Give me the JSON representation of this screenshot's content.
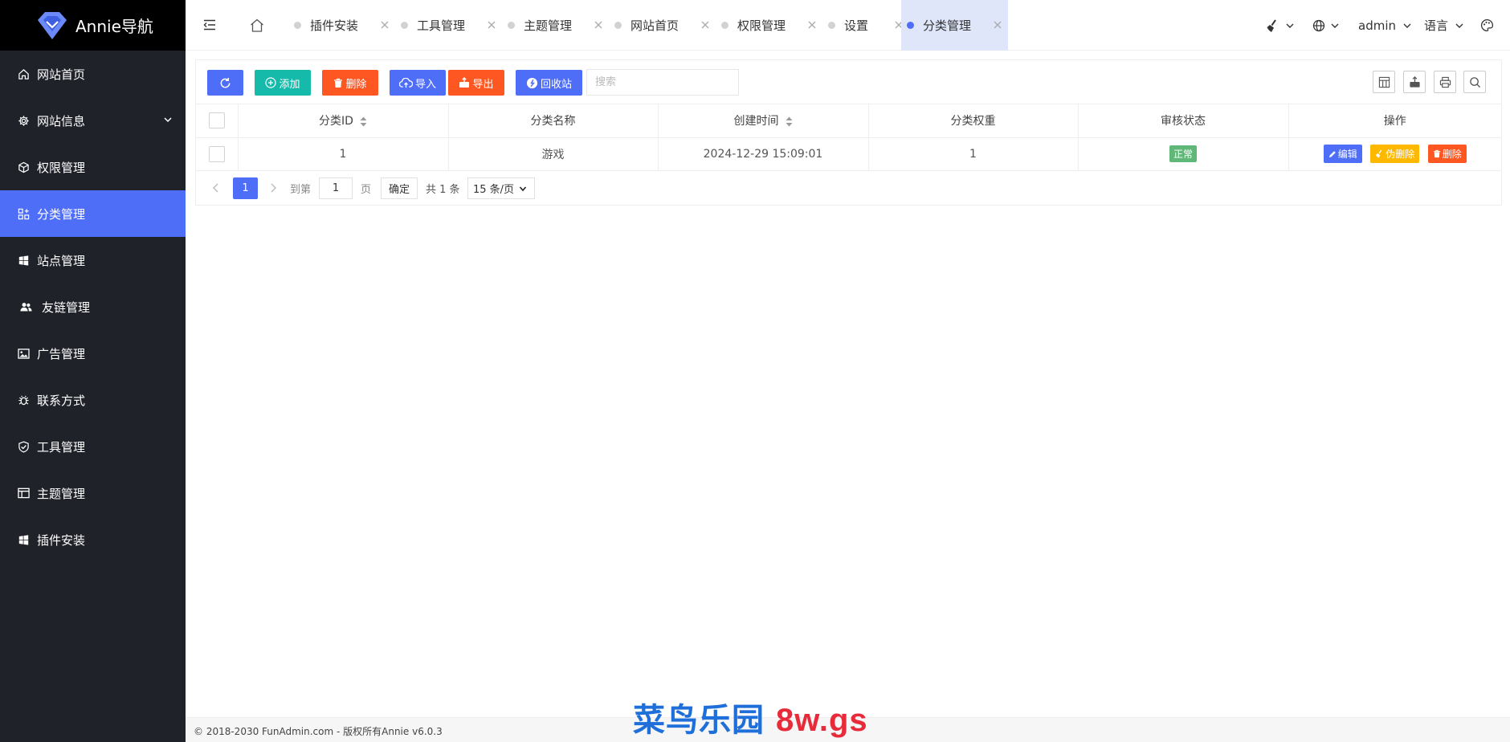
{
  "app": {
    "title": "Annie导航"
  },
  "sidebar": {
    "items": [
      {
        "label": "网站首页",
        "icon": "home-icon"
      },
      {
        "label": "网站信息",
        "icon": "gear-icon",
        "has_submenu": true
      },
      {
        "label": "权限管理",
        "icon": "cube-icon"
      },
      {
        "label": "分类管理",
        "icon": "grid-icon",
        "active": true
      },
      {
        "label": "站点管理",
        "icon": "windows-icon"
      },
      {
        "label": "友链管理",
        "icon": "users-icon"
      },
      {
        "label": "广告管理",
        "icon": "image-icon"
      },
      {
        "label": "联系方式",
        "icon": "bug-icon"
      },
      {
        "label": "工具管理",
        "icon": "shield-icon"
      },
      {
        "label": "主题管理",
        "icon": "layout-icon"
      },
      {
        "label": "插件安装",
        "icon": "windows-icon"
      }
    ]
  },
  "tabs": [
    {
      "label": "插件安装"
    },
    {
      "label": "工具管理"
    },
    {
      "label": "主题管理"
    },
    {
      "label": "网站首页"
    },
    {
      "label": "权限管理"
    },
    {
      "label": "设置"
    },
    {
      "label": "分类管理",
      "active": true
    }
  ],
  "topbar": {
    "user": "admin",
    "language": "语言"
  },
  "toolbar": {
    "add": "添加",
    "delete": "删除",
    "import": "导入",
    "export": "导出",
    "recycle": "回收站",
    "search_placeholder": "搜索"
  },
  "table": {
    "headers": [
      "分类ID",
      "分类名称",
      "创建时间",
      "分类权重",
      "审核状态",
      "操作"
    ],
    "rows": [
      {
        "id": "1",
        "name": "游戏",
        "created": "2024-12-29 15:09:01",
        "weight": "1",
        "status": "正常"
      }
    ],
    "actions": {
      "edit": "编辑",
      "soft_delete": "伪删除",
      "delete": "删除"
    }
  },
  "pager": {
    "current": "1",
    "goto_prefix": "到第",
    "goto_value": "1",
    "goto_suffix": "页",
    "confirm": "确定",
    "total": "共 1 条",
    "page_size": "15 条/页"
  },
  "footer": {
    "text": "© 2018-2030 FunAdmin.com - 版权所有Annie v6.0.3"
  },
  "watermark": {
    "part1": "菜鸟乐园",
    "part2": "8w.gs"
  },
  "colors": {
    "primary": "#4f6ef7",
    "teal": "#16baaa",
    "orange_red": "#ff5722",
    "yellow": "#ffb800",
    "green": "#5fb878",
    "sidebar_bg": "#20222a"
  }
}
